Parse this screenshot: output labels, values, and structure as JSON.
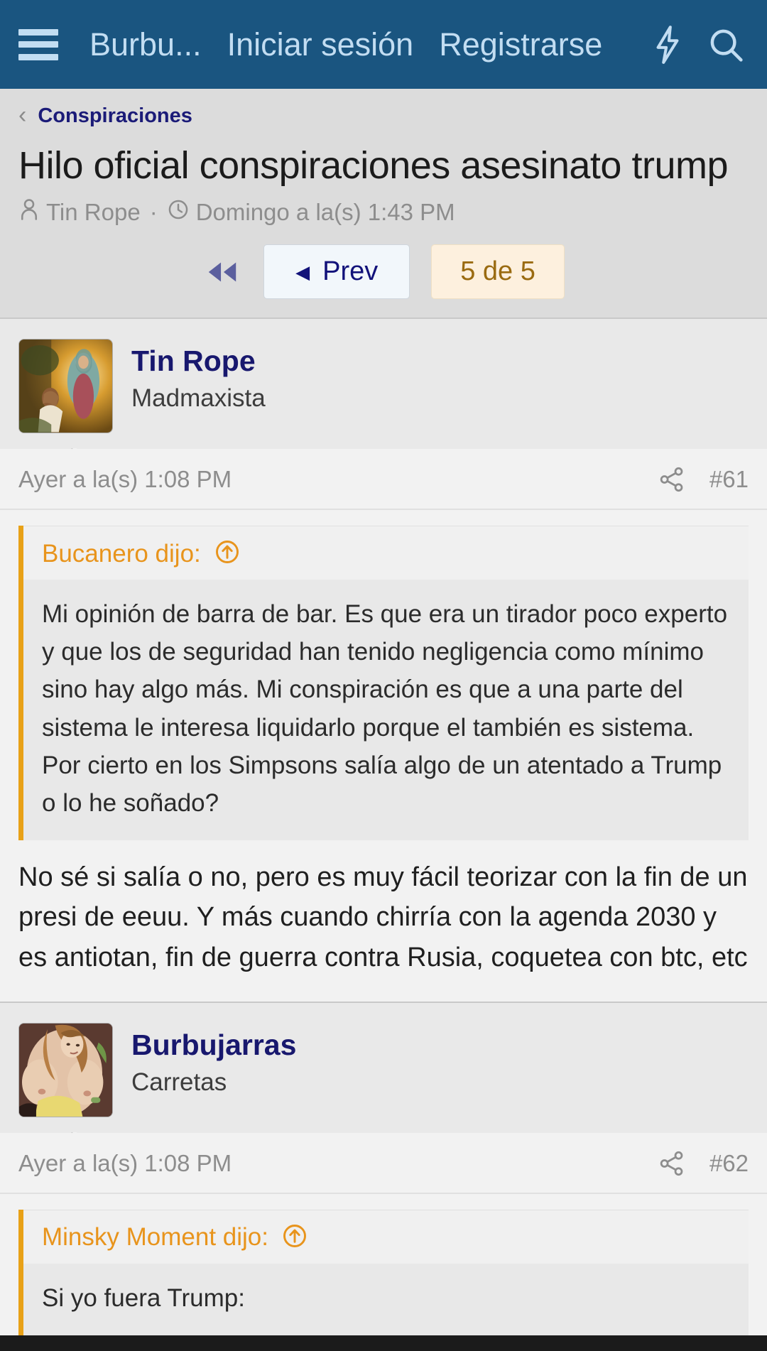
{
  "appbar": {
    "menu_icon": "hamburger-menu-icon",
    "site_title": "Burbu...",
    "login_label": "Iniciar sesión",
    "register_label": "Registrarse",
    "bolt_icon": "lightning-bolt-icon",
    "search_icon": "search-icon",
    "background": "#1a5580",
    "text_color": "#c2ddf2"
  },
  "thread": {
    "breadcrumb_back_icon": "chevron-left-icon",
    "breadcrumb_label": "Conspiraciones",
    "title": "Hilo oficial conspiraciones asesinato trump",
    "author_icon": "user-icon",
    "author": "Tin Rope",
    "separator": "·",
    "time_icon": "clock-icon",
    "date": "Domingo a la(s) 1:43 PM"
  },
  "pager": {
    "first_icon": "double-left-arrow-icon",
    "prev_caret": "◀",
    "prev_label": "Prev",
    "current_label": "5 de 5"
  },
  "posts": [
    {
      "author_name": "Tin Rope",
      "author_title": "Madmaxista",
      "avatar_name": "avatar-tin-rope",
      "date": "Ayer a la(s) 1:08 PM",
      "share_icon": "share-icon",
      "post_number": "#61",
      "quote": {
        "author_label": "Bucanero dijo:",
        "jump_icon": "arrow-up-circle-icon",
        "text": "Mi opinión de barra de bar. Es que era un tirador poco experto y que los de seguridad han tenido negligencia como mínimo sino hay algo más. Mi conspiración es que a una parte del sistema le interesa liquidarlo porque el también es sistema. Por cierto en los Simpsons salía algo de un atentado a Trump o lo he soñado?"
      },
      "text": "No sé si salía o no, pero es muy fácil teorizar con la fin de un presi de eeuu. Y más cuando chirría con la agenda 2030 y es antiotan, fin de guerra contra Rusia, coquetea con btc, etc"
    },
    {
      "author_name": "Burbujarras",
      "author_title": "Carretas",
      "avatar_name": "avatar-burbujarras",
      "date": "Ayer a la(s) 1:08 PM",
      "share_icon": "share-icon",
      "post_number": "#62",
      "quote": {
        "author_label": "Minsky Moment dijo:",
        "jump_icon": "arrow-up-circle-icon",
        "text": "Si yo fuera Trump:"
      },
      "text": ""
    }
  ],
  "colors": {
    "accent_orange": "#e8a117",
    "link_navy": "#18186e",
    "muted_gray": "#8d8d8d",
    "page_bg": "#f2f2f2",
    "head_bg": "#dcdcdc"
  }
}
